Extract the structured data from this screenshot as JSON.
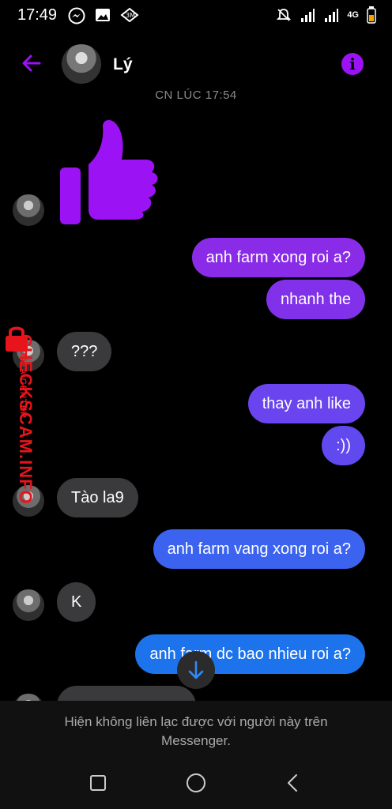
{
  "status_bar": {
    "time": "17:49",
    "network": "4G",
    "icons": [
      "messenger-icon",
      "image-icon",
      "app-icon",
      "mute-icon",
      "signal-icon",
      "signal-icon",
      "battery-icon"
    ]
  },
  "header": {
    "contact_name": "Lý",
    "accent_color": "#9b12f5"
  },
  "conversation": {
    "timestamp": "CN LÚC 17:54",
    "messages": [
      {
        "dir": "in",
        "type": "like"
      },
      {
        "dir": "out",
        "text": "anh farm xong roi a?"
      },
      {
        "dir": "out",
        "text": "nhanh the"
      },
      {
        "dir": "in",
        "text": "???"
      },
      {
        "dir": "out",
        "text": "thay anh like"
      },
      {
        "dir": "out",
        "text": ":))"
      },
      {
        "dir": "in",
        "text": "Tào la9"
      },
      {
        "dir": "out",
        "text": "anh farm vang xong roi a?"
      },
      {
        "dir": "in",
        "text": "K"
      },
      {
        "dir": "out",
        "text": "anh farm dc bao nhieu roi a?"
      }
    ]
  },
  "footer": {
    "notice": "Hiện không liên lạc được với người này trên Messenger."
  },
  "watermark": {
    "main": "CHECKSCAM.INFO",
    "sub": "DATA CENTER"
  }
}
